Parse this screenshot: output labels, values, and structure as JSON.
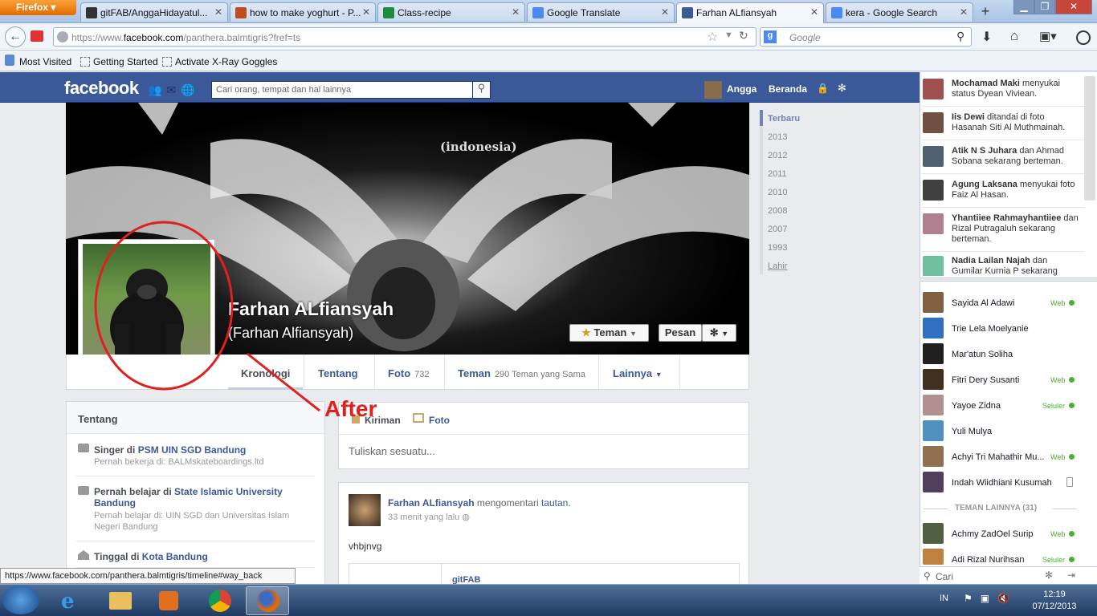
{
  "browser": {
    "button": "Firefox",
    "tabs": [
      {
        "label": "gitFAB/AnggaHidayatul...",
        "color": "#333333"
      },
      {
        "label": "how to make yoghurt - P...",
        "color": "#c04b1c"
      },
      {
        "label": "Class-recipe",
        "color": "#1e8c3a"
      },
      {
        "label": "Google Translate",
        "color": "#4a8af4"
      },
      {
        "label": "Farhan ALfiansyah",
        "color": "#3b5998"
      },
      {
        "label": "kera - Google Search",
        "color": "#4a8af4"
      }
    ],
    "url_prefix": "https://www.",
    "url_domain": "facebook.com",
    "url_path": "/panthera.balmtigris?fref=ts",
    "search_placeholder": "Google",
    "bookmarks": [
      "Most Visited",
      "Getting Started",
      "Activate X-Ray Goggles"
    ]
  },
  "fb": {
    "logo": "facebook",
    "search_placeholder": "Cari orang, tempat dan hal lainnya",
    "user": "Angga",
    "home": "Beranda",
    "profile": {
      "name": "Farhan ALfiansyah",
      "alt_name": "(Farhan Alfiansyah)",
      "cover_text": "(indonesia)",
      "friend_btn": "Teman",
      "message_btn": "Pesan"
    },
    "tabs": {
      "timeline": "Kronologi",
      "about": "Tentang",
      "photos": "Foto",
      "photos_count": "732",
      "friends": "Teman",
      "friends_sub": "290 Teman yang Sama",
      "more": "Lainnya"
    },
    "years": [
      "Terbaru",
      "2013",
      "2012",
      "2011",
      "2010",
      "2008",
      "2007",
      "1993",
      "Lahir"
    ],
    "about": {
      "title": "Tentang",
      "items": [
        {
          "main_a": "Singer di ",
          "main_link": "PSM UIN SGD Bandung",
          "sub": "Pernah bekerja di: BALMskateboardings.ltd"
        },
        {
          "main_a": "Pernah belajar di ",
          "main_link": "State Islamic University Bandung",
          "sub": "Pernah belajar di: UIN SGD dan Universitas Islam Negeri Bandung"
        },
        {
          "main_a": "Tinggal di ",
          "main_link": "Kota Bandung",
          "sub": ""
        }
      ]
    },
    "composer": {
      "post_tab": "Kiriman",
      "photo_tab": "Foto",
      "placeholder": "Tuliskan sesuatu..."
    },
    "post": {
      "author": "Farhan ALfiansyah",
      "action": " mengomentari ",
      "object": "tautan.",
      "time": "33 menit yang lalu",
      "text": "vhbjnvg",
      "link_title": "gitFAB"
    },
    "ticker": [
      {
        "name": "Mochamad Maki",
        "text": " menyukai status Dyean Viviean.",
        "color": "#a05050"
      },
      {
        "name": "Iis Dewi",
        "text": " ditandai di foto Hasanah Siti Al Muthmainah.",
        "color": "#705040"
      },
      {
        "name": "Atik N S Juhara",
        "text": " dan Ahmad Sobana sekarang berteman.",
        "color": "#506070"
      },
      {
        "name": "Agung Laksana",
        "text": " menyukai foto Faiz Al Hasan.",
        "color": "#404040"
      },
      {
        "name": "Yhantiiee Rahmayhantiiee",
        "text": " dan Rizal Putragaluh sekarang berteman.",
        "color": "#b08090"
      },
      {
        "name": "Nadia Lailan Najah",
        "text": " dan Gumilar Kurnia P sekarang",
        "color": "#70c0a0"
      }
    ],
    "chat": [
      {
        "name": "Sayida Al Adawi",
        "status": "Web",
        "color": "#806040"
      },
      {
        "name": "Trie Lela Moelyanie",
        "status": "",
        "color": "#3070c0"
      },
      {
        "name": "Mar'atun Soliha",
        "status": "",
        "color": "#202020"
      },
      {
        "name": "Fitri Dery Susanti",
        "status": "Web",
        "color": "#403020"
      },
      {
        "name": "Yayoe Zidna",
        "status": "Seluler",
        "color": "#b09090"
      },
      {
        "name": "Yuli Mulya",
        "status": "",
        "color": "#5090c0"
      },
      {
        "name": "Achyi Tri Mahathir Mu...",
        "status": "Web",
        "color": "#907050"
      },
      {
        "name": "Indah Wiidhiani Kusumah",
        "status": "mobile",
        "color": "#504060"
      }
    ],
    "more_friends": "TEMAN LAINNYA (31)",
    "chat2": [
      {
        "name": "Achmy ZadOel Surip",
        "status": "Web",
        "color": "#506040"
      },
      {
        "name": "Adi Rizal Nurihsan",
        "status": "Seluler",
        "color": "#c08040"
      }
    ],
    "chat_search": "Cari"
  },
  "statusbar": "https://www.facebook.com/panthera.balmtigris/timeline#way_back",
  "annotation": "After",
  "taskbar": {
    "lang": "IN",
    "time": "12:19",
    "date": "07/12/2013"
  }
}
